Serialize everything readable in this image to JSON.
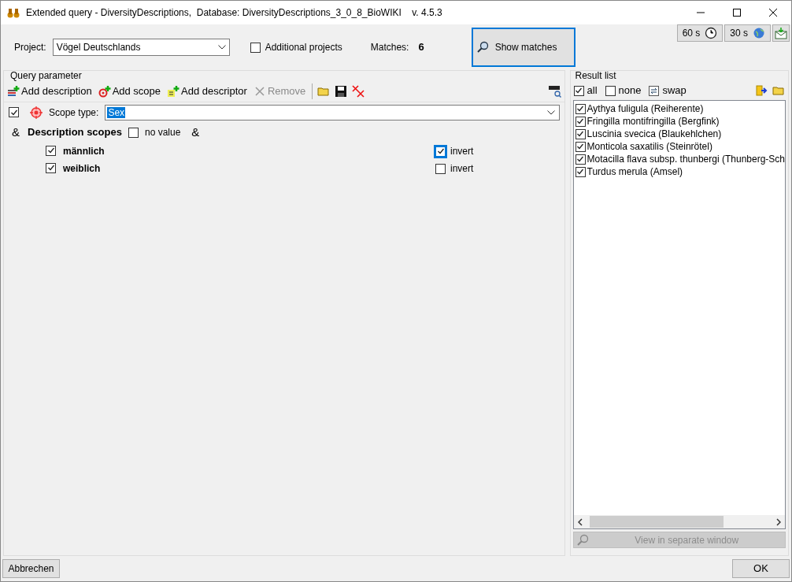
{
  "window": {
    "title": "Extended query - DiversityDescriptions,  Database: DiversityDescriptions_3_0_8_BioWIKI    v. 4.5.3"
  },
  "header": {
    "project_label": "Project:",
    "project_value": "Vögel Deutschlands",
    "additional_projects": {
      "label": "Additional projects",
      "checked": false
    },
    "matches_label": "Matches:",
    "matches_value": "6",
    "show_matches": "Show matches",
    "timers": [
      {
        "label": "60 s",
        "kind": "clock"
      },
      {
        "label": "30 s",
        "kind": "globe"
      }
    ]
  },
  "query_parameter": {
    "title": "Query parameter",
    "toolbar": [
      {
        "label": "Add description",
        "kind": "description",
        "disabled": false
      },
      {
        "label": "Add scope",
        "kind": "scope",
        "disabled": false
      },
      {
        "label": "Add descriptor",
        "kind": "descriptor",
        "disabled": false
      },
      {
        "label": "Remove",
        "kind": "remove",
        "disabled": true
      }
    ],
    "scope": {
      "checked": true,
      "label": "Scope type:",
      "value": "Sex"
    },
    "operator": "&",
    "description_scopes": {
      "label": "Description scopes",
      "no_value": {
        "label": "no value",
        "checked": false
      },
      "operator": "&",
      "items": [
        {
          "label": "männlich",
          "checked": true,
          "invert": {
            "label": "invert",
            "checked": true,
            "focused": true
          }
        },
        {
          "label": "weiblich",
          "checked": true,
          "invert": {
            "label": "invert",
            "checked": false,
            "focused": false
          }
        }
      ]
    }
  },
  "result_list": {
    "title": "Result list",
    "select": [
      {
        "label": "all",
        "kind": "check",
        "checked": true
      },
      {
        "label": "none",
        "kind": "check",
        "checked": false
      },
      {
        "label": "swap",
        "kind": "swap"
      }
    ],
    "items": [
      {
        "label": "Aythya fuligula (Reiherente)",
        "checked": true
      },
      {
        "label": "Fringilla montifringilla (Bergfink)",
        "checked": true
      },
      {
        "label": "Luscinia svecica (Blaukehlchen)",
        "checked": true
      },
      {
        "label": "Monticola saxatilis (Steinrötel)",
        "checked": true
      },
      {
        "label": "Motacilla flava subsp. thunbergi (Thunberg-Sch",
        "checked": true
      },
      {
        "label": "Turdus merula (Amsel)",
        "checked": true
      }
    ],
    "view_button": {
      "label": "View in separate window",
      "disabled": true
    }
  },
  "buttons": {
    "cancel": "Abbrechen",
    "ok": "OK"
  }
}
